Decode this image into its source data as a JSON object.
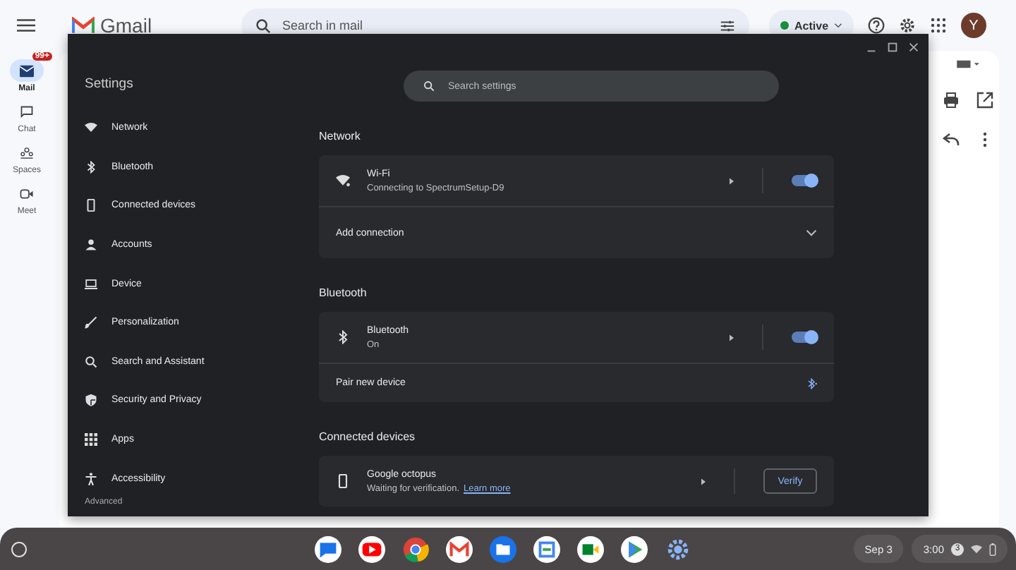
{
  "gmail": {
    "logo": "Gmail",
    "search_placeholder": "Search in mail",
    "status": "Active",
    "avatar": "Y",
    "rail": [
      {
        "label": "Mail",
        "selected": true,
        "badge": "99+"
      },
      {
        "label": "Chat",
        "selected": false
      },
      {
        "label": "Spaces",
        "selected": false
      },
      {
        "label": "Meet",
        "selected": false
      }
    ]
  },
  "settings": {
    "title": "Settings",
    "search_placeholder": "Search settings",
    "nav": [
      {
        "label": "Network"
      },
      {
        "label": "Bluetooth"
      },
      {
        "label": "Connected devices"
      },
      {
        "label": "Accounts"
      },
      {
        "label": "Device"
      },
      {
        "label": "Personalization"
      },
      {
        "label": "Search and Assistant"
      },
      {
        "label": "Security and Privacy"
      },
      {
        "label": "Apps"
      },
      {
        "label": "Accessibility"
      }
    ],
    "advanced": "Advanced",
    "sections": [
      {
        "title": "Network",
        "rows": [
          {
            "kind": "toggle",
            "title": "Wi-Fi",
            "subtitle": "Connecting to SpectrumSetup-D9",
            "on": true
          },
          {
            "kind": "expand",
            "title": "Add connection"
          }
        ]
      },
      {
        "title": "Bluetooth",
        "rows": [
          {
            "kind": "toggle",
            "title": "Bluetooth",
            "subtitle": "On",
            "on": true
          },
          {
            "kind": "pair",
            "title": "Pair new device"
          }
        ]
      },
      {
        "title": "Connected devices",
        "rows": [
          {
            "kind": "action",
            "title": "Google octopus",
            "subtitle": "Waiting for verification.",
            "link": "Learn more",
            "button": "Verify"
          }
        ]
      }
    ]
  },
  "shelf": {
    "date": "Sep 3",
    "time": "3:00",
    "notifications": "3"
  }
}
